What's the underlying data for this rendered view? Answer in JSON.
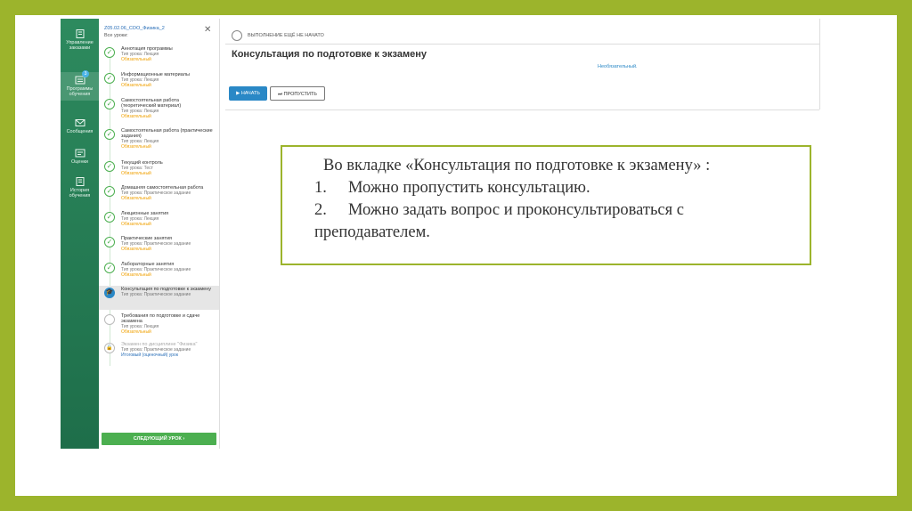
{
  "nav": [
    {
      "label": "Управление заказами",
      "icon": "orders-icon"
    },
    {
      "label": "Программы обучения",
      "icon": "programs-icon",
      "badge": "3"
    },
    {
      "label": "Сообщения",
      "icon": "mail-icon"
    },
    {
      "label": "Оценки",
      "icon": "grades-icon"
    },
    {
      "label": "История обучения",
      "icon": "history-icon"
    }
  ],
  "panel": {
    "course": "Z05.02.06_СОО_Физика_2",
    "all_lessons": "Все уроки:",
    "close": "✕",
    "next_button": "СЛЕДУЮЩИЙ УРОК ›"
  },
  "lessons": [
    {
      "title": "Аннотация программы",
      "type": "Тип урока: Лекция",
      "req": "Обязательный",
      "state": "done"
    },
    {
      "title": "Информационные материалы",
      "type": "Тип урока: Лекция",
      "req": "Обязательный",
      "state": "done"
    },
    {
      "title": "Самостоятельная работа (теоретический материал)",
      "type": "Тип урока: Лекция",
      "req": "Обязательный",
      "state": "done"
    },
    {
      "title": "Самостоятельная работа (практические задания)",
      "type": "Тип урока: Лекция",
      "req": "Обязательный",
      "state": "done"
    },
    {
      "title": "Текущий контроль",
      "type": "Тип урока: Тест",
      "req": "Обязательный",
      "state": "done"
    },
    {
      "title": "Домашняя самостоятельная работа",
      "type": "Тип урока: Практическое задание",
      "req": "Обязательный",
      "state": "done"
    },
    {
      "title": "Лекционные занятия",
      "type": "Тип урока: Лекция",
      "req": "Обязательный",
      "state": "done"
    },
    {
      "title": "Практические занятия",
      "type": "Тип урока: Практическое задание",
      "req": "Обязательный",
      "state": "done"
    },
    {
      "title": "Лабораторные занятия",
      "type": "Тип урока: Практическое задание",
      "req": "Обязательный",
      "state": "done"
    },
    {
      "title": "Консультация по подготовке к экзамену",
      "type": "Тип урока: Практическое задание",
      "req": "",
      "state": "current"
    },
    {
      "title": "Требования по подготовке и сдаче экзамена",
      "type": "Тип урока: Лекция",
      "req": "Обязательный",
      "state": "empty"
    },
    {
      "title": "Экзамен по дисциплине \"Физика\"",
      "type": "Тип урока: Практическое задание",
      "req": "Итоговый (оценочный) урок",
      "state": "locked"
    }
  ],
  "main": {
    "status": "ВЫПОЛНЕНИЕ ЕЩЁ НЕ НАЧАТО",
    "title": "Консультация по подготовке к экзамену",
    "optional": "Необязательный.",
    "start_button": "▶  НАЧАТЬ",
    "skip_button": "⏭  ПРОПУСТИТЬ"
  },
  "callout": {
    "intro": "Во вкладке «Консультация по подготовке к экзамену» :",
    "items": [
      {
        "n": "1.",
        "text": "Можно пропустить консультацию."
      },
      {
        "n": "2.",
        "text": "Можно задать вопрос и проконсультироваться с преподавателем."
      }
    ]
  },
  "colors": {
    "frame": "#9cb42c",
    "nav": "#1e6e4a",
    "accent": "#2a88c6",
    "check": "#4caf50",
    "required": "#f0a000"
  }
}
